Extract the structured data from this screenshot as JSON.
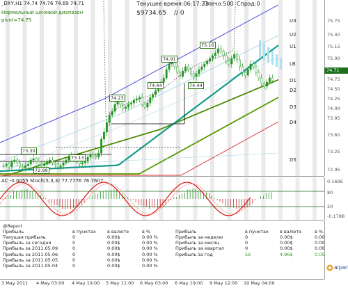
{
  "symbol_header": "_DXY,H1  74.74 74.76 74.69 74.71",
  "indicator_name": "Нормальный ценовой диапазон",
  "pivot_label": "pivot=74.75",
  "server_time_label": "Текущее время:06:17:23",
  "leverage_label": "Плечо:500",
  "spread_label": "Спрэд:0",
  "balance": "$9734.65",
  "slash_label": "// 0",
  "level_labels": [
    "U3",
    "U2",
    "U1",
    "LB",
    "D1",
    "D2",
    "D3",
    "D4",
    "D5"
  ],
  "price_ticks": [
    "75.75",
    "75.40",
    "75.15",
    "75.00",
    "74.75",
    "74.50",
    "74.25",
    "74.00",
    "73.95",
    "73.60",
    "73.25",
    "72.95"
  ],
  "current_price": "74.71",
  "box_labels": [
    "75.16",
    "74.91",
    "74.44",
    "74.44",
    "74.23",
    "73.30",
    "72.99",
    "73.13"
  ],
  "osc_header": "AC -0.0055 Stoch(5,3,3) 77.7776 76.7607",
  "osc_ticks": [
    "0.1696",
    "80",
    "20",
    "-0.1788"
  ],
  "report": {
    "title": "@Report",
    "left_header": [
      "Прибыль",
      "в пунктах",
      "в валюте",
      "в %"
    ],
    "left_rows": [
      [
        "Текущая прибыль",
        "0",
        "0.00$",
        "0.00 %"
      ],
      [
        "Прибыль за сегодня",
        "0",
        "0.00$",
        "0.00 %"
      ],
      [
        "Прибыль за 2011.05.09",
        "0",
        "0.00$",
        "0.00 %"
      ],
      [
        "Прибыль за 2011.05.06",
        "0",
        "0.00$",
        "0.00 %"
      ],
      [
        "Прибыль за 2011.05.05",
        "0",
        "0.00$",
        "0.00 %"
      ],
      [
        "Прибыль за 2011.05.04",
        "0",
        "0.00$",
        "0.00 %"
      ]
    ],
    "right_header": [
      "Прибыль",
      "в пунктах",
      "в валюте",
      "в %"
    ],
    "right_rows": [
      [
        "Прибыль за неделю",
        "0",
        "0.00$",
        "0.00 %"
      ],
      [
        "Прибыль за месяц",
        "0",
        "0.00$",
        "0.00 %"
      ],
      [
        "Прибыль за квартал",
        "0",
        "0.00$",
        "0.00 %"
      ],
      [
        "Прибыль за год",
        "56",
        "4.96$",
        "0.05 %"
      ]
    ],
    "brand": "alpari"
  },
  "time_ticks": [
    "3 May 2011",
    "4 May 03:00",
    "4 May 19:00",
    "5 May 11:00",
    "6 May 03:00",
    "6 May 19:00",
    "9 May 12:00",
    "10 May 04:00"
  ],
  "colors": {
    "upper_band": "#3b3bdc",
    "green_line": "#4a8a00",
    "mid_line": "#119a8a",
    "red_line": "#d43030",
    "candle": "#229922",
    "stoch": "#e01010"
  }
}
